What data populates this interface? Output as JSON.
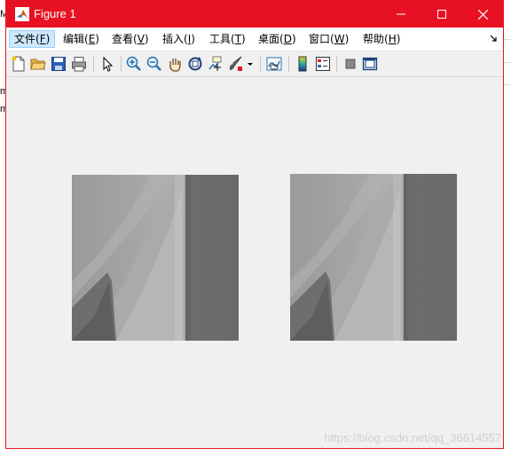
{
  "background": {
    "left_fragment_chars": [
      "M",
      "m",
      "m"
    ]
  },
  "window": {
    "title": "Figure 1",
    "accent_color": "#e81123",
    "controls": [
      "minimize-icon",
      "maximize-icon",
      "close-icon"
    ]
  },
  "menubar": {
    "items": [
      {
        "label": "文件(",
        "key": "F",
        "suffix": ")"
      },
      {
        "label": "编辑(",
        "key": "E",
        "suffix": ")"
      },
      {
        "label": "查看(",
        "key": "V",
        "suffix": ")"
      },
      {
        "label": "插入(",
        "key": "I",
        "suffix": ")"
      },
      {
        "label": "工具(",
        "key": "T",
        "suffix": ")"
      },
      {
        "label": "桌面(",
        "key": "D",
        "suffix": ")"
      },
      {
        "label": "窗口(",
        "key": "W",
        "suffix": ")"
      },
      {
        "label": "帮助(",
        "key": "H",
        "suffix": ")"
      }
    ]
  },
  "toolbar": {
    "icons": [
      "new-figure-icon",
      "open-file-icon",
      "save-icon",
      "print-icon",
      "edit-plot-icon",
      "zoom-in-icon",
      "zoom-out-icon",
      "pan-icon",
      "rotate-3d-icon",
      "data-cursor-icon",
      "brush-icon",
      "link-plot-icon",
      "colorbar-icon",
      "legend-icon",
      "hide-plot-tools-icon",
      "show-plot-tools-icon"
    ]
  },
  "figure": {
    "images": [
      "left-grayscale-image",
      "right-grayscale-image"
    ],
    "watermark": "https://blog.csdn.net/qq_36614557"
  }
}
